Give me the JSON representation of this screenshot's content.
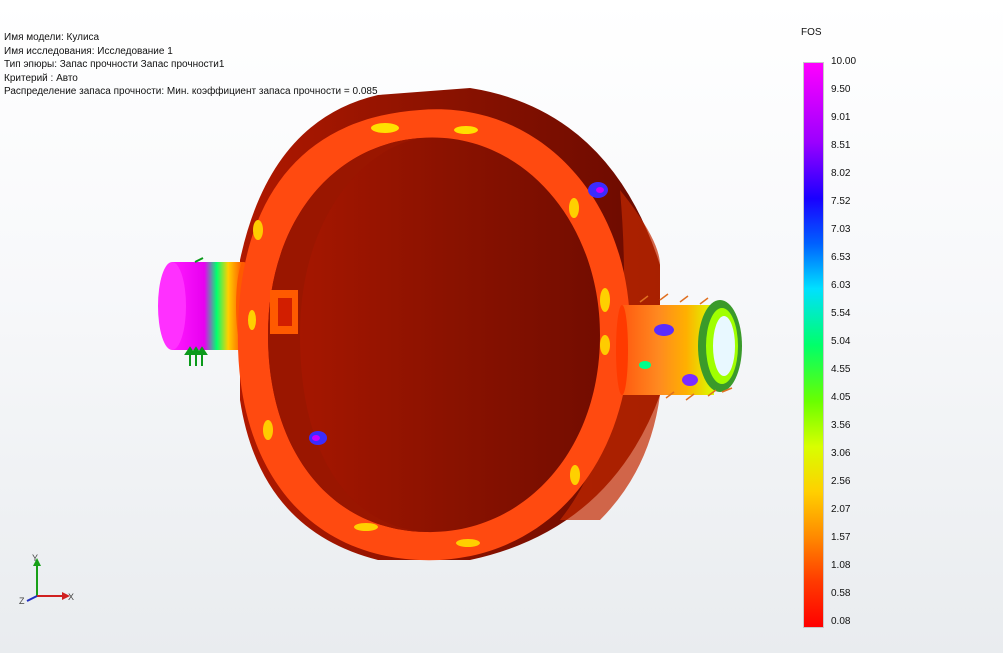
{
  "info": {
    "model": "Имя модели: Кулиса",
    "study": "Имя исследования: Исследование 1",
    "plot_type": "Тип эпюры: Запас прочности Запас прочности1",
    "criterion": "Критерий : Авто",
    "distribution": "Распределение запаса прочности: Мин. коэффициент запаса прочности = 0.085"
  },
  "legend": {
    "title": "FOS",
    "ticks": [
      "10.00",
      "9.50",
      "9.01",
      "8.51",
      "8.02",
      "7.52",
      "7.03",
      "6.53",
      "6.03",
      "5.54",
      "5.04",
      "4.55",
      "4.05",
      "3.56",
      "3.06",
      "2.56",
      "2.07",
      "1.57",
      "1.08",
      "0.58",
      "0.08"
    ],
    "colors": {
      "max": "#ff00ff",
      "mid": "#00ff6a",
      "min": "#ff0000"
    }
  },
  "triad": {
    "x": "X",
    "y": "Y",
    "z": "Z"
  },
  "icons": {
    "triad": "coordinate-triad-icon",
    "fixture": "fixture-arrows-icon",
    "load": "load-arrows-icon"
  }
}
